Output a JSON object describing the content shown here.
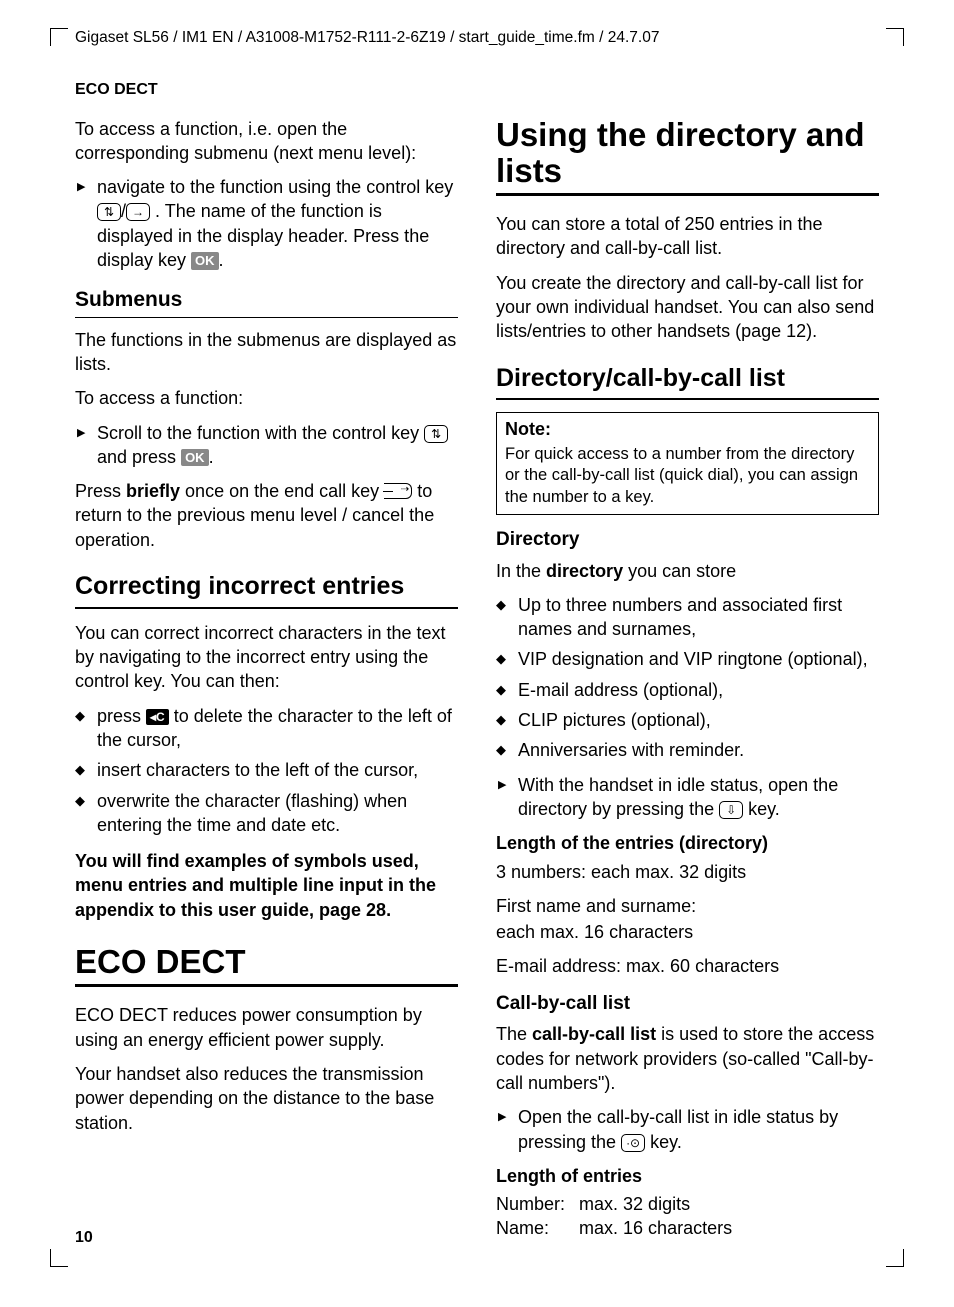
{
  "header_path": "Gigaset SL56 / IM1 EN / A31008-M1752-R111-2-6Z19 / start_guide_time.fm / 24.7.07",
  "running_head": "ECO DECT",
  "page_number": "10",
  "left": {
    "intro_p": "To access a function, i.e. open the corresponding submenu (next menu level):",
    "intro_li_a": "navigate to the function using the control key ",
    "intro_li_b": ". The name of the function is displayed in the display header. Press the display key ",
    "intro_li_c": ".",
    "key_updown": "⇅",
    "key_right": "→",
    "ok_label": "OK",
    "submenus_h": "Submenus",
    "submenus_p1": "The functions in the submenus are displayed as lists.",
    "submenus_p2": "To access a function:",
    "submenus_li_a": "Scroll to the function with the control key ",
    "submenus_li_b": " and press ",
    "submenus_li_c": ".",
    "press_a": "Press ",
    "press_bold": "briefly",
    "press_b": " once on the end call key ",
    "press_c": " to return to the previous menu level / cancel the operation.",
    "correct_h": "Correcting incorrect entries",
    "correct_p": "You can correct incorrect characters in the text by navigating to the incorrect entry using the control key. You can then:",
    "c_label": "◂C",
    "correct_li1_a": "press ",
    "correct_li1_b": " to delete the character to the left of the cursor,",
    "correct_li2": "insert characters to the left of the cursor,",
    "correct_li3": "overwrite the character (flashing) when entering the time and date etc.",
    "appendix_note": "You will find examples of symbols used, menu entries and multiple line input in the appendix to this user guide, page 28.",
    "eco_h": "ECO DECT",
    "eco_p1": "ECO DECT reduces power consumption by using an energy efficient power supply.",
    "eco_p2": "Your handset also reduces the transmission power depending on the distance to the base station."
  },
  "right": {
    "using_h": "Using the directory and lists",
    "using_p1": "You can store a total of 250 entries in the directory and call-by-call list.",
    "using_p2": "You create the directory and call-by-call list for your own individual handset. You can also send lists/entries to other handsets (page 12).",
    "dircbc_h": "Directory/call-by-call list",
    "note_title": "Note:",
    "note_body": "For quick access to a number from the directory or the call-by-call list (quick dial), you can assign the number to a key.",
    "directory_h": "Directory",
    "directory_p_a": "In the ",
    "directory_p_bold": "directory",
    "directory_p_b": " you can store",
    "dir_li1": "Up to three numbers and associated first names and surnames,",
    "dir_li2": "VIP designation and VIP ringtone (optional),",
    "dir_li3": "E-mail address (optional),",
    "dir_li4": "CLIP pictures (optional),",
    "dir_li5": "Anniversaries with reminder.",
    "dir_arrow_a": "With the handset in idle status, open the directory by pressing the ",
    "dir_arrow_b": " key.",
    "key_down": "⇩",
    "len_dir_h": "Length of the entries (directory)",
    "len_dir_p1": "3 numbers: each max. 32 digits",
    "len_dir_p2a": "First name and surname:",
    "len_dir_p2b": "each max. 16 characters",
    "len_dir_p3": "E-mail address: max. 60 characters",
    "cbc_h": "Call-by-call list",
    "cbc_p_a": "The ",
    "cbc_p_bold": "call-by-call list",
    "cbc_p_b": " is used to store the access codes for network providers (so-called \"Call-by-call numbers\").",
    "cbc_arrow_a": "Open the call-by-call list in idle status by pressing the ",
    "cbc_arrow_b": " key.",
    "key_cbc": "·⊙",
    "len_h": "Length of entries",
    "len_r1a": "Number:",
    "len_r1b": "max. 32 digits",
    "len_r2a": "Name:",
    "len_r2b": "max. 16 characters"
  }
}
